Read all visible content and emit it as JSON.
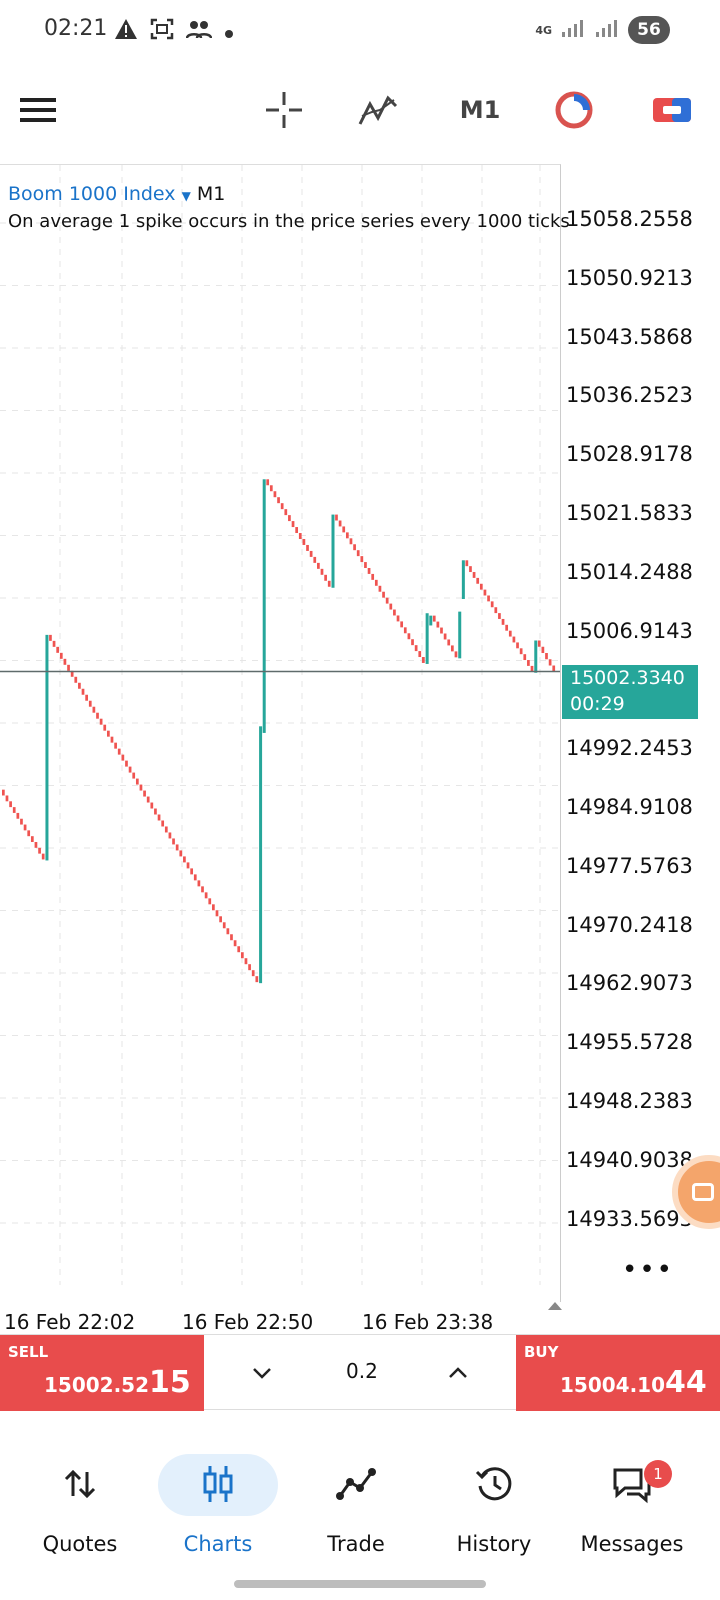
{
  "status_bar": {
    "time": "02:21",
    "network": "4G",
    "battery": "56",
    "icons": [
      "warning-icon",
      "scan-icon",
      "people-icon",
      "dot-icon"
    ]
  },
  "toolbar": {
    "timeframe": "M1",
    "icons": [
      "menu-icon",
      "crosshair-icon",
      "indicators-icon",
      "timer-icon",
      "trade-ticket-icon"
    ]
  },
  "chart": {
    "symbol": "Boom 1000 Index",
    "timeframe": "M1",
    "description": "On average 1 spike occurs in the price series every 1000 ticks",
    "price_labels": [
      "15058.2558",
      "15050.9213",
      "15043.5868",
      "15036.2523",
      "15028.9178",
      "15021.5833",
      "15014.2488",
      "15006.9143",
      "14992.2453",
      "14984.9108",
      "14977.5763",
      "14970.2418",
      "14962.9073",
      "14955.5728",
      "14948.2383",
      "14940.9038",
      "14933.5693"
    ],
    "current_price": "15002.3340",
    "countdown": "00:29",
    "time_labels": [
      "16 Feb 22:02",
      "16 Feb 22:50",
      "16 Feb 23:38"
    ],
    "more": "•••"
  },
  "chart_data": {
    "type": "candlestick",
    "title": "Boom 1000 Index",
    "timeframe": "M1",
    "y_axis_ticks": [
      15058.2558,
      15050.9213,
      15043.5868,
      15036.2523,
      15028.9178,
      15021.5833,
      15014.2488,
      15006.9143,
      14992.2453,
      14984.9108,
      14977.5763,
      14970.2418,
      14962.9073,
      14955.5728,
      14948.2383,
      14940.9038,
      14933.5693
    ],
    "x_axis_ticks": [
      "16 Feb 22:02",
      "16 Feb 22:50",
      "16 Feb 23:38"
    ],
    "current_price": 15002.334,
    "up_color": "#26a69a",
    "down_color": "#ef5350",
    "price_path": [
      {
        "type": "drift",
        "from": 14987.6,
        "to": 14978.9,
        "spike": false
      },
      {
        "type": "spike",
        "from": 14978.9,
        "to": 15006.9
      },
      {
        "type": "drift",
        "from": 15006.9,
        "to": 14963.6
      },
      {
        "type": "spike",
        "from": 14963.6,
        "to": 14995.5
      },
      {
        "type": "spike",
        "from": 14994.8,
        "to": 15026.3
      },
      {
        "type": "drift",
        "from": 15026.3,
        "to": 15012.9
      },
      {
        "type": "spike",
        "from": 15012.9,
        "to": 15021.9
      },
      {
        "type": "drift",
        "from": 15021.9,
        "to": 15003.4
      },
      {
        "type": "spike",
        "from": 15003.4,
        "to": 15009.6
      },
      {
        "type": "spike",
        "from": 15008.2,
        "to": 15009.3
      },
      {
        "type": "drift",
        "from": 15009.3,
        "to": 15004.1
      },
      {
        "type": "spike",
        "from": 15004.1,
        "to": 15009.8
      },
      {
        "type": "spike",
        "from": 15011.5,
        "to": 15016.2
      },
      {
        "type": "drift",
        "from": 15016.2,
        "to": 15002.3
      },
      {
        "type": "spike",
        "from": 15002.3,
        "to": 15006.2
      },
      {
        "type": "drift",
        "from": 15006.2,
        "to": 15002.3
      }
    ]
  },
  "trade": {
    "sell_label": "SELL",
    "sell_price_main": "15002.52",
    "sell_price_big": "15",
    "buy_label": "BUY",
    "buy_price_main": "15004.10",
    "buy_price_big": "44",
    "volume": "0.2"
  },
  "nav": {
    "items": [
      {
        "label": "Quotes",
        "icon": "quotes-icon"
      },
      {
        "label": "Charts",
        "icon": "charts-icon"
      },
      {
        "label": "Trade",
        "icon": "trade-icon"
      },
      {
        "label": "History",
        "icon": "history-icon"
      },
      {
        "label": "Messages",
        "icon": "messages-icon"
      }
    ],
    "active": "Charts",
    "messages_badge": "1"
  },
  "colors": {
    "accent": "#1a73c9",
    "sell": "#e84c4c",
    "buy": "#e84c4c",
    "bull_candle": "#26a69a",
    "bear_candle": "#ef5350",
    "current_price_box": "#26a69a"
  }
}
